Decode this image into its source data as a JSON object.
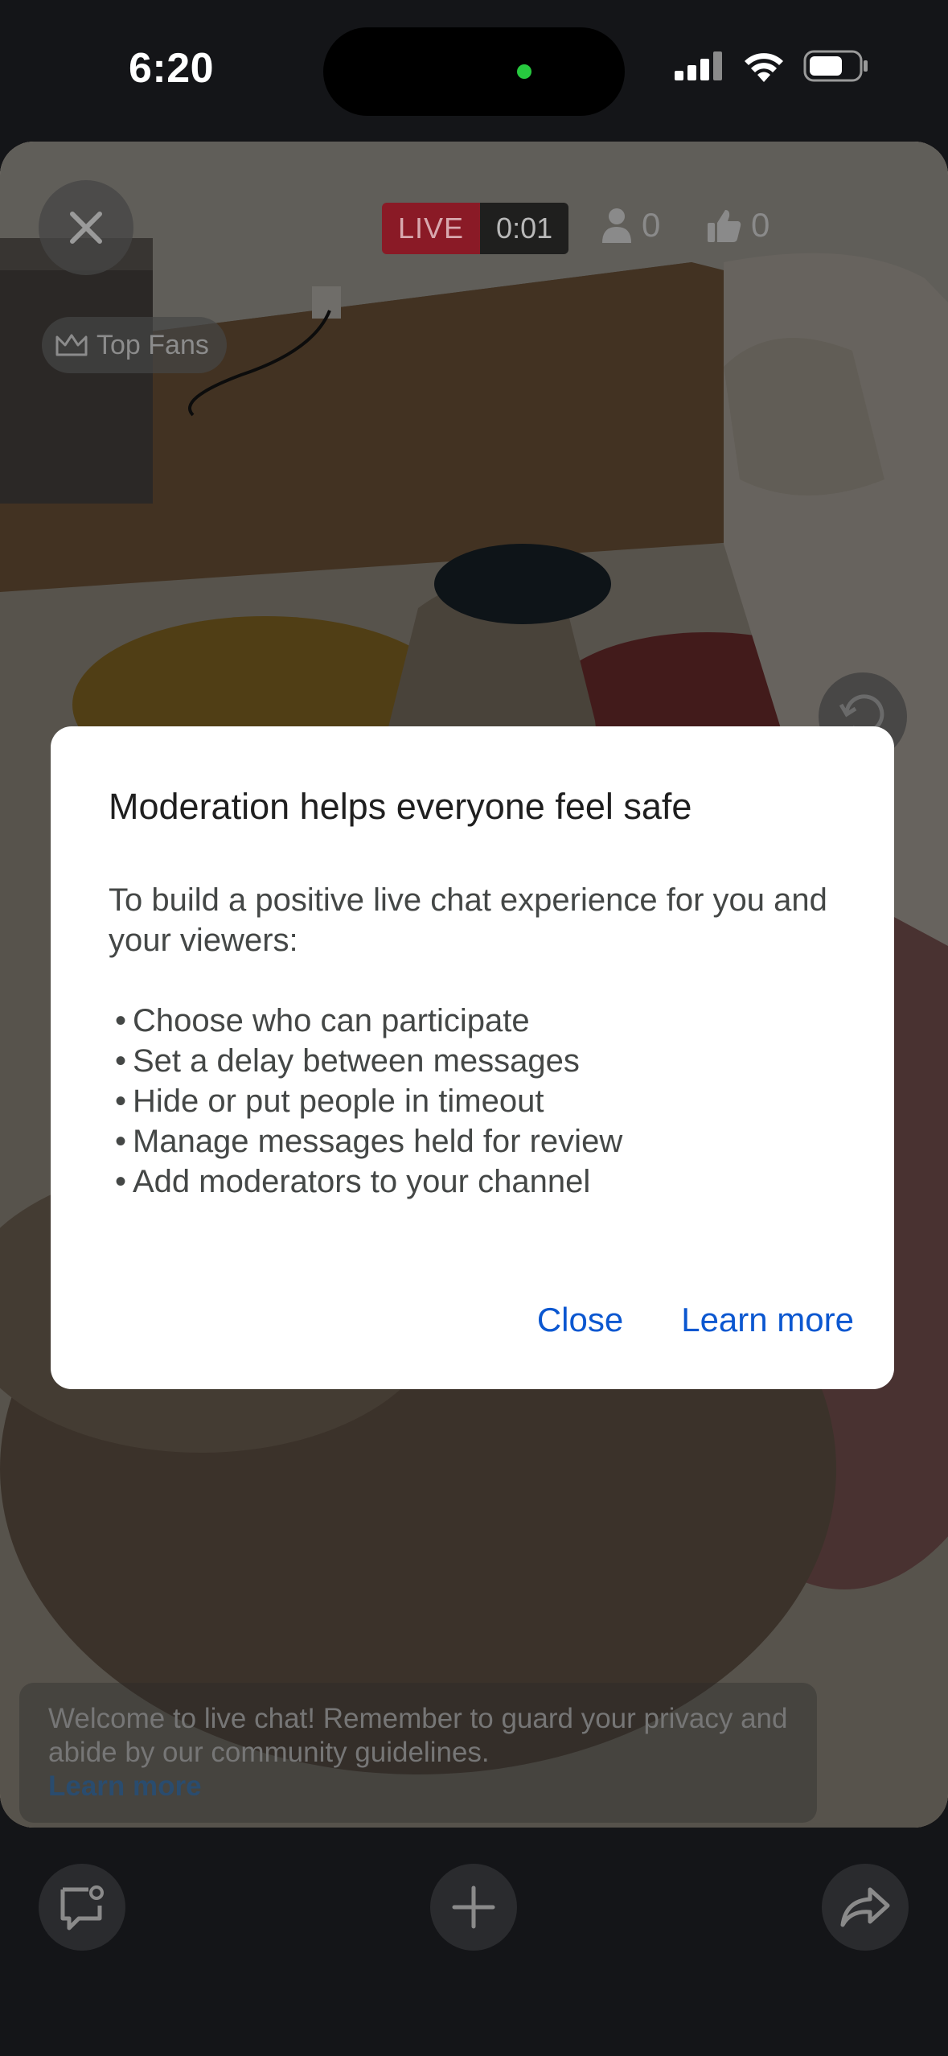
{
  "status_bar": {
    "time": "6:20",
    "signal_icon": "cellular-signal-icon",
    "wifi_icon": "wifi-icon",
    "battery_icon": "battery-icon"
  },
  "stream": {
    "live_label": "LIVE",
    "elapsed": "0:01",
    "viewer_count": "0",
    "like_count": "0",
    "top_fans_label": "Top Fans"
  },
  "chat_notice": {
    "text": "Welcome to live chat! Remember to guard your privacy and abide by our community guidelines.",
    "link": "Learn more"
  },
  "dialog": {
    "title": "Moderation helps everyone feel safe",
    "intro": "To build a positive live chat experience for you and your viewers:",
    "bullets": [
      "Choose who can participate",
      "Set a delay between messages",
      "Hide or put people in timeout",
      "Manage messages held for review",
      "Add moderators to your channel"
    ],
    "close_label": "Close",
    "learn_more_label": "Learn more"
  },
  "bottom_bar": {
    "chat_settings_icon": "chat-settings-icon",
    "add_icon": "plus-icon",
    "share_icon": "share-icon"
  },
  "colors": {
    "accent": "#0b57d0",
    "live_red": "#c8102e",
    "background": "#141518"
  }
}
